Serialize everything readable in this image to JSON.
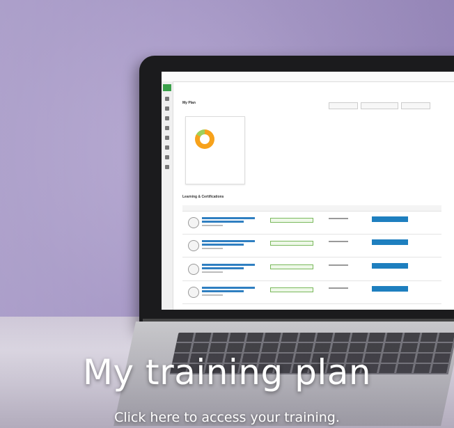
{
  "banner": {
    "headline": "My training plan",
    "subline": "Click here to access your training.",
    "headline_color": "#ffffff",
    "background_color": "#a698c6"
  },
  "screen": {
    "page_title": "My Plan",
    "section_title": "Learning & Certifications"
  }
}
